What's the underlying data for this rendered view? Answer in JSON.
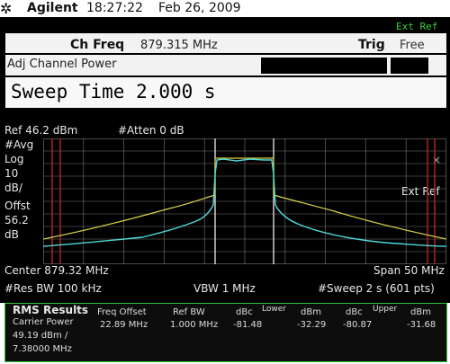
{
  "titlebar": {
    "logo": "✲",
    "brand": "Agilent",
    "time": "18:27:22",
    "date": "Feb 26, 2009"
  },
  "header": {
    "ext_ref": "Ext Ref",
    "ch_freq_label": "Ch Freq",
    "ch_freq_value": "879.315 MHz",
    "trig_label": "Trig",
    "trig_value": "Free",
    "mode": "Adj Channel Power",
    "sweep_time": "Sweep Time 2.000  s"
  },
  "graph": {
    "ref": "Ref 46.2 dBm",
    "atten": "#Atten 0 dB",
    "left_labels": [
      "#Avg",
      "Log",
      "10",
      "dB/",
      "Offst",
      "56.2",
      "dB"
    ],
    "ext_ref": "Ext Ref",
    "marker": "×",
    "center": "Center 879.32 MHz",
    "span": "Span 50 MHz",
    "res_bw": "#Res BW 100 kHz",
    "vbw": "VBW 1 MHz",
    "sweep": "#Sweep 2 s (601 pts)",
    "colors": {
      "trace_cyan": "#4fd6d6",
      "trace_yellow": "#d8d24a",
      "marker_red": "#c02222",
      "grid": "#7a7a7a",
      "boundary": "#ffffff"
    }
  },
  "results": {
    "title": "RMS Results",
    "carrier_power_label": "Carrier Power",
    "carrier_power_value": "49.19 dBm /",
    "carrier_bandwidth": "7.38000 MHz",
    "headers": {
      "freq_offset": "Freq Offset",
      "ref_bw": "Ref BW",
      "dbc1": "dBc",
      "lower": "Lower",
      "dbm1": "dBm",
      "dbc2": "dBc",
      "upper": "Upper",
      "dbm2": "dBm"
    },
    "row": {
      "freq_offset": "22.89 MHz",
      "ref_bw": "1.000 MHz",
      "lower_dbc": "-81.48",
      "lower_dbm": "-32.29",
      "upper_dbc": "-80.87",
      "upper_dbm": "-31.68"
    }
  }
}
